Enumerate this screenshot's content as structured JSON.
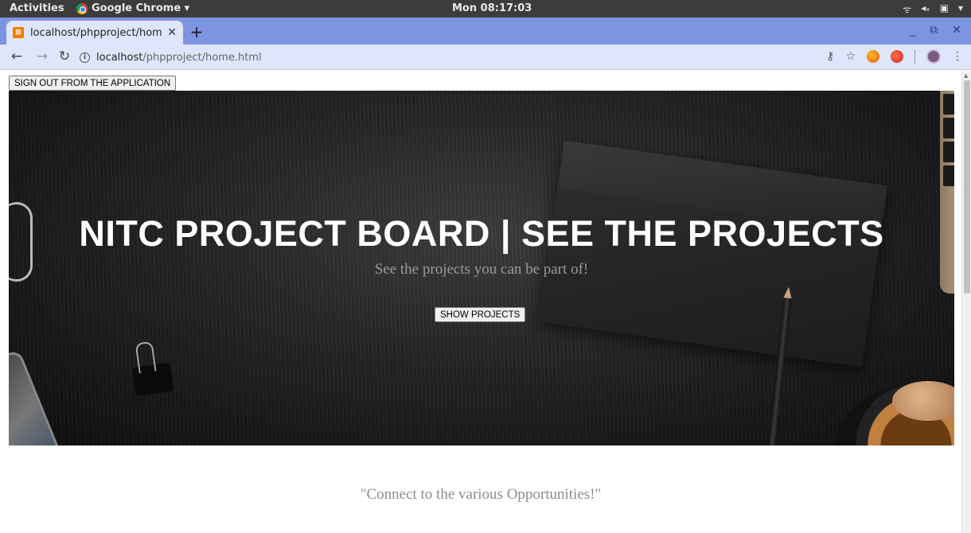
{
  "system_bar": {
    "activities": "Activities",
    "app_name": "Google Chrome ▾",
    "clock": "Mon 08:17:03"
  },
  "browser": {
    "tab_title": "localhost/phpproject/hom",
    "url_host": "localhost",
    "url_path": "/phpproject/home.html"
  },
  "page": {
    "signout_label": "SIGN OUT FROM THE APPLICATION",
    "hero_title": "NITC PROJECT BOARD | SEE THE PROJECTS",
    "hero_subtitle": "See the projects you can be part of!",
    "show_projects_label": "SHOW PROJECTS",
    "quote": "\"Connect to the various Opportunities!\""
  },
  "colors": {
    "tab_strip": "#7d94e0",
    "toolbar": "#dfe6fb",
    "hero_dark": "#242424"
  },
  "icons": [
    "chrome-logo-icon",
    "favicon-icon",
    "close-icon",
    "plus-icon",
    "back-icon",
    "forward-icon",
    "reload-icon",
    "info-icon",
    "key-icon",
    "star-icon",
    "extension-icon",
    "profile-icon",
    "menu-icon"
  ]
}
